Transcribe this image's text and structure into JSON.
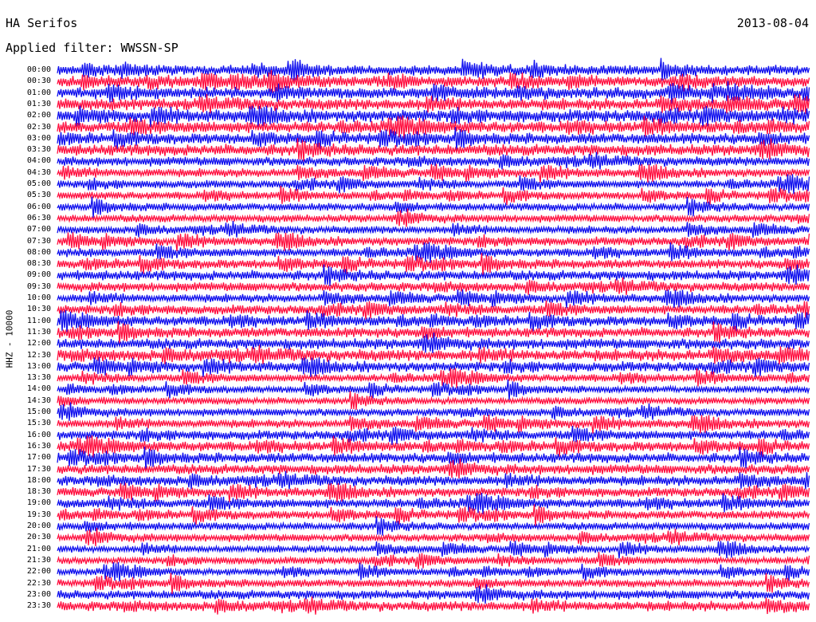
{
  "header": {
    "station": "HA Serifos",
    "date": "2013-08-04",
    "filter": "Applied filter: WWSSN-SP",
    "channel": "HHZ - 10000"
  },
  "colors": {
    "trace_blue": "#1010ee",
    "trace_red": "#ff1040",
    "background": "#ffffff",
    "text": "#000000"
  },
  "chart_data": {
    "type": "line",
    "title": "HA Serifos",
    "ylabel": "HHZ - 10000",
    "legend": "none",
    "grid": false,
    "trace_color_cycle": [
      "#1010ee",
      "#ff1040"
    ],
    "row_labels": [
      "00:00",
      "00:30",
      "01:00",
      "01:30",
      "02:00",
      "02:30",
      "03:00",
      "03:30",
      "04:00",
      "04:30",
      "05:00",
      "05:30",
      "06:00",
      "06:30",
      "07:00",
      "07:30",
      "08:00",
      "08:30",
      "09:00",
      "09:30",
      "10:00",
      "10:30",
      "11:00",
      "11:30",
      "12:00",
      "12:30",
      "13:00",
      "13:30",
      "14:00",
      "14:30",
      "15:00",
      "15:30",
      "16:00",
      "16:30",
      "17:00",
      "17:30",
      "18:00",
      "18:30",
      "19:00",
      "19:30",
      "20:00",
      "20:30",
      "21:00",
      "21:30",
      "22:00",
      "22:30",
      "23:00",
      "23:30"
    ],
    "row_colors": [
      "blue",
      "red",
      "blue",
      "red",
      "blue",
      "red",
      "blue",
      "red",
      "blue",
      "red",
      "blue",
      "red",
      "blue",
      "red",
      "blue",
      "red",
      "blue",
      "red",
      "blue",
      "red",
      "blue",
      "red",
      "blue",
      "red",
      "blue",
      "red",
      "blue",
      "red",
      "blue",
      "red",
      "blue",
      "red",
      "blue",
      "red",
      "blue",
      "red",
      "blue",
      "red",
      "blue",
      "red",
      "blue",
      "red",
      "blue",
      "red",
      "blue",
      "red",
      "blue",
      "red"
    ],
    "row_activity": [
      1.3,
      1.4,
      1.5,
      1.5,
      1.6,
      1.5,
      1.4,
      1.5,
      1.2,
      1.1,
      1.0,
      1.0,
      1.0,
      1.0,
      1.0,
      1.1,
      1.1,
      1.2,
      1.3,
      1.2,
      1.1,
      1.2,
      1.3,
      1.3,
      1.4,
      1.5,
      1.3,
      1.0,
      0.9,
      0.9,
      1.0,
      1.1,
      1.2,
      1.3,
      1.3,
      1.3,
      1.3,
      1.2,
      1.2,
      1.1,
      1.0,
      1.0,
      0.9,
      0.9,
      0.9,
      1.0,
      1.2,
      1.3
    ]
  }
}
